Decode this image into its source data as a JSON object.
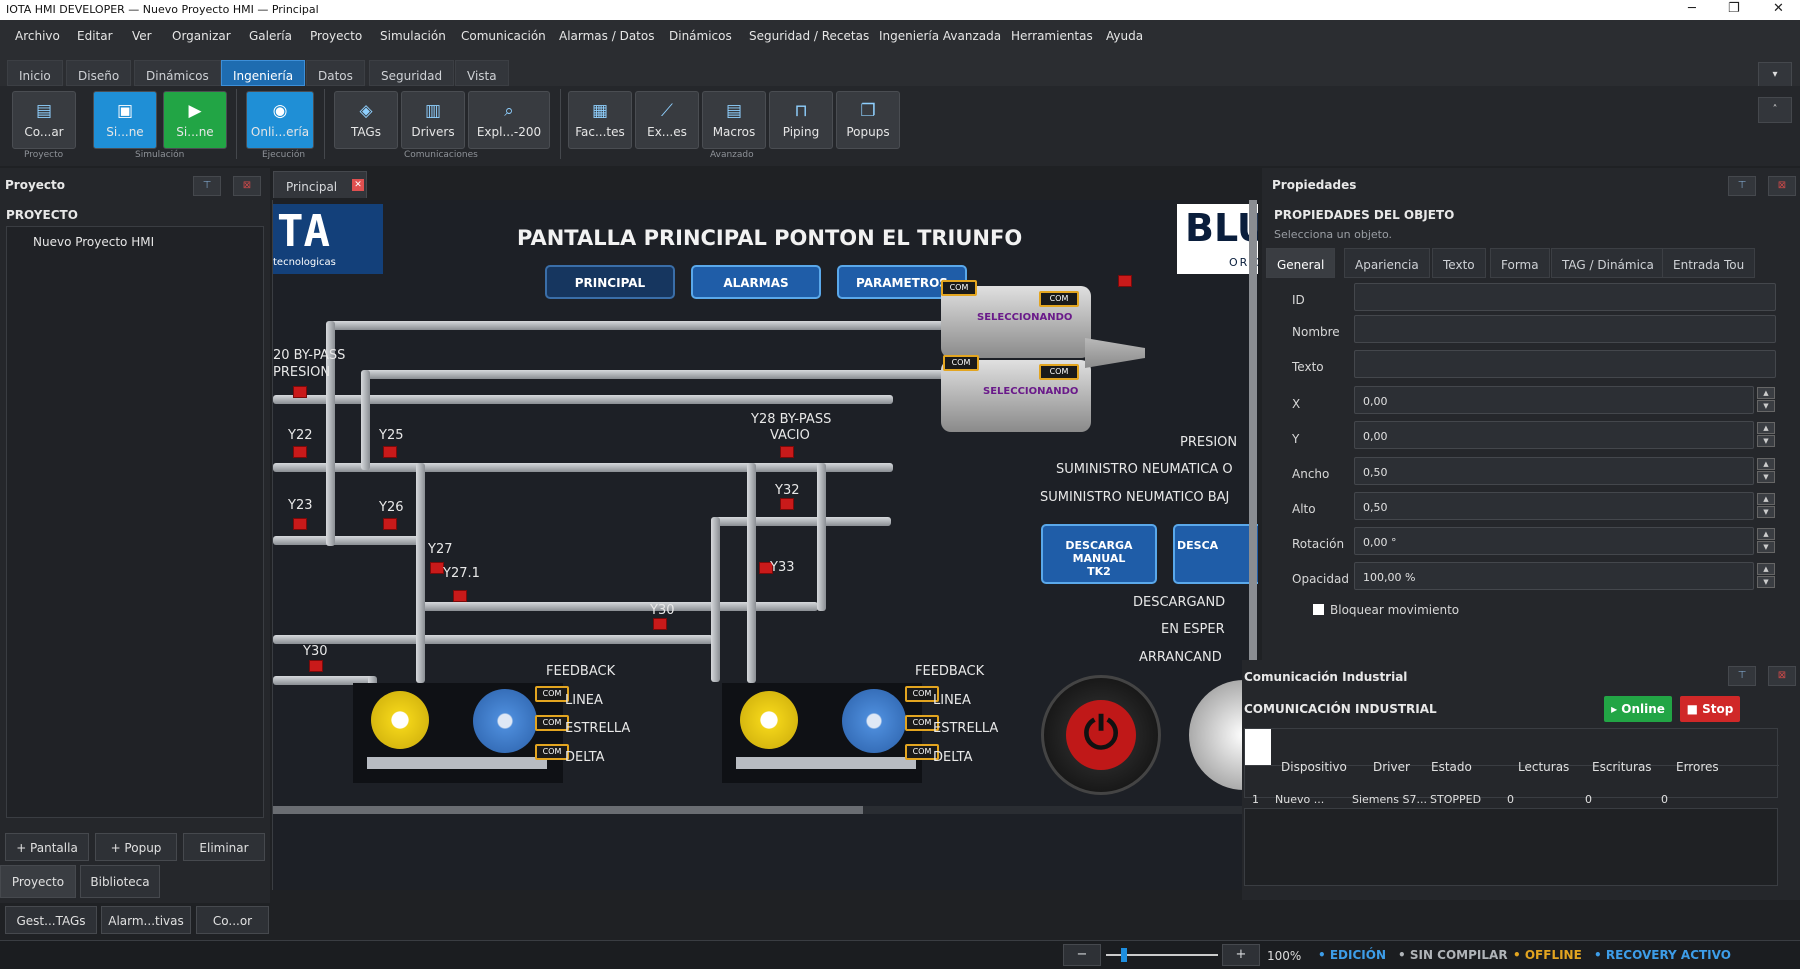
{
  "window": {
    "title": "IOTA HMI DEVELOPER — Nuevo Proyecto HMI — Principal",
    "min": "─",
    "max": "❐",
    "close": "✕"
  },
  "menu": [
    "Archivo",
    "Editar",
    "Ver",
    "Organizar",
    "Galería",
    "Proyecto",
    "Simulación",
    "Comunicación",
    "Alarmas / Datos",
    "Dinámicos",
    "Seguridad / Recetas",
    "Ingeniería Avanzada",
    "Herramientas",
    "Ayuda"
  ],
  "ribbon_tabs": [
    "Inicio",
    "Diseño",
    "Dinámicos",
    "Ingeniería",
    "Datos",
    "Seguridad",
    "Vista"
  ],
  "ribbon_buttons": [
    {
      "label": "Co...ar",
      "icon": "compile-icon"
    },
    {
      "label": "Si...ne",
      "icon": "simulate-icon"
    },
    {
      "label": "Si...ne",
      "icon": "simulate-play-icon"
    },
    {
      "label": "Onli...ería",
      "icon": "online-icon"
    },
    {
      "label": "TAGs",
      "icon": "tag-icon"
    },
    {
      "label": "Drivers",
      "icon": "drivers-icon"
    },
    {
      "label": "Expl...-200",
      "icon": "explorer-icon"
    },
    {
      "label": "Fac...tes",
      "icon": "faceplate-icon"
    },
    {
      "label": "Ex...es",
      "icon": "chart-icon"
    },
    {
      "label": "Macros",
      "icon": "macro-icon"
    },
    {
      "label": "Piping",
      "icon": "piping-icon"
    },
    {
      "label": "Popups",
      "icon": "popup-icon"
    }
  ],
  "ribbon_groups": [
    "Proyecto",
    "Simulación",
    "Ejecución",
    "Comunicaciones",
    "Avanzado"
  ],
  "project": {
    "title": "Proyecto",
    "heading": "PROYECTO",
    "tree_item": "Nuevo Proyecto HMI",
    "btn_screen": "+ Pantalla",
    "btn_popup": "+ Popup",
    "btn_delete": "Eliminar",
    "tab_project": "Proyecto",
    "tab_library": "Biblioteca",
    "btn_tags": "Gest...TAGs",
    "btn_alarms": "Alarm...tivas",
    "btn_co": "Co...or"
  },
  "doc_tab": "Principal",
  "screen": {
    "logo_left": "TA",
    "logo_left_sub": "tecnologicas",
    "logo_right": "BLU",
    "logo_right_sub": "ORIG",
    "title": "PANTALLA PRINCIPAL PONTON EL TRIUNFO",
    "nav_principal": "PRINCIPAL",
    "nav_alarmas": "ALARMAS",
    "nav_parametros": "PARAMETROS",
    "bypass_pres_1": "20 BY-PASS",
    "bypass_pres_2": "PRESION",
    "bypass_vac_1": "Y28 BY-PASS",
    "bypass_vac_2": "VACIO",
    "valves": [
      "Y22",
      "Y25",
      "Y23",
      "Y26",
      "Y27",
      "Y27.1",
      "Y32",
      "Y33",
      "Y30",
      "Y30"
    ],
    "presion": "PRESION",
    "sum1": "SUMINISTRO NEUMATICA O",
    "sum2": "SUMINISTRO NEUMATICO BAJ",
    "desc_manual_1": "DESCARGA MANUAL",
    "desc_manual_2": "TK2",
    "desc_cut": "DESCA",
    "descargando": "DESCARGAND",
    "espera": "EN ESPER",
    "arrancando": "ARRANCAND",
    "feedback": "FEEDBACK",
    "linea": "LINEA",
    "estrella": "ESTRELLA",
    "delta": "DELTA",
    "com": "COM",
    "tank_status": "SELECCIONANDO"
  },
  "props": {
    "title": "Propiedades",
    "heading": "PROPIEDADES DEL OBJETO",
    "hint": "Selecciona un objeto.",
    "tabs": [
      "General",
      "Apariencia",
      "Texto",
      "Forma",
      "TAG / Dinámica",
      "Entrada Tou"
    ],
    "fields": [
      {
        "label": "ID",
        "value": ""
      },
      {
        "label": "Nombre",
        "value": ""
      },
      {
        "label": "Texto",
        "value": ""
      },
      {
        "label": "X",
        "value": "0,00"
      },
      {
        "label": "Y",
        "value": "0,00"
      },
      {
        "label": "Ancho",
        "value": "0,50"
      },
      {
        "label": "Alto",
        "value": "0,50"
      },
      {
        "label": "Rotación",
        "value": "0,00 °"
      },
      {
        "label": "Opacidad",
        "value": "100,00 %"
      }
    ],
    "lock": "Bloquear movimiento"
  },
  "comm": {
    "title": "Comunicación Industrial",
    "heading": "COMUNICACIÓN INDUSTRIAL",
    "online": "▸ Online",
    "stop": "■ Stop",
    "columns": [
      "Dispositivo",
      "Driver",
      "Estado",
      "Lecturas",
      "Escrituras",
      "Errores"
    ],
    "row": {
      "num": "1",
      "device": "Nuevo ...",
      "driver": "Siemens S7...",
      "state": "STOPPED",
      "reads": "0",
      "writes": "0",
      "errors": "0"
    }
  },
  "status": {
    "zoom_minus": "−",
    "zoom_plus": "+",
    "zoom": "100%",
    "mode": "• EDICIÓN",
    "compile": "• SIN COMPILAR",
    "offline": "• OFFLINE",
    "recovery": "• RECOVERY ACTIVO"
  },
  "colors": {
    "accent": "#1e6cb0",
    "online": "#22a545",
    "stop": "#d02828",
    "warn": "#e3a520",
    "valve": "#c91a1a"
  }
}
